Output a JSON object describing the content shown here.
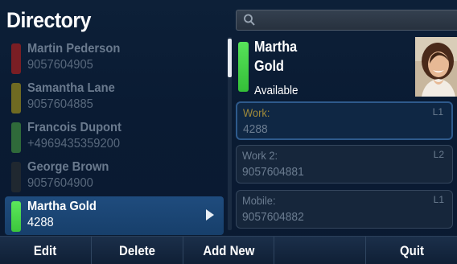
{
  "header": {
    "title": "Directory",
    "search_placeholder": ""
  },
  "contacts": [
    {
      "name": "Martin Pederson",
      "number": "9057604905",
      "status_color": "#7a1e24",
      "selected": false
    },
    {
      "name": "Samantha Lane",
      "number": "9057604885",
      "status_color": "#6f6a22",
      "selected": false
    },
    {
      "name": "Francois Dupont",
      "number": "+4969435359200",
      "status_color": "#2f6a3a",
      "selected": false
    },
    {
      "name": "George Brown",
      "number": "9057604900",
      "status_color": "#202830",
      "selected": false
    },
    {
      "name": "Martha Gold",
      "number": "4288",
      "status_color": "#4fd94f",
      "selected": true
    }
  ],
  "detail": {
    "first_name": "Martha",
    "last_name": "Gold",
    "presence": "Available",
    "status_color": "#4fd94f",
    "fields": [
      {
        "label": "Work:",
        "value": "4288",
        "line": "L1",
        "active": true
      },
      {
        "label": "Work 2:",
        "value": "9057604881",
        "line": "L2",
        "active": false
      },
      {
        "label": "Mobile:",
        "value": "9057604882",
        "line": "L1",
        "active": false
      }
    ]
  },
  "softkeys": [
    "Edit",
    "Delete",
    "Add New",
    "",
    "Quit"
  ],
  "icons": {
    "search": "search-icon",
    "selected_arrow": "play-arrow-icon",
    "avatar": "contact-photo"
  }
}
